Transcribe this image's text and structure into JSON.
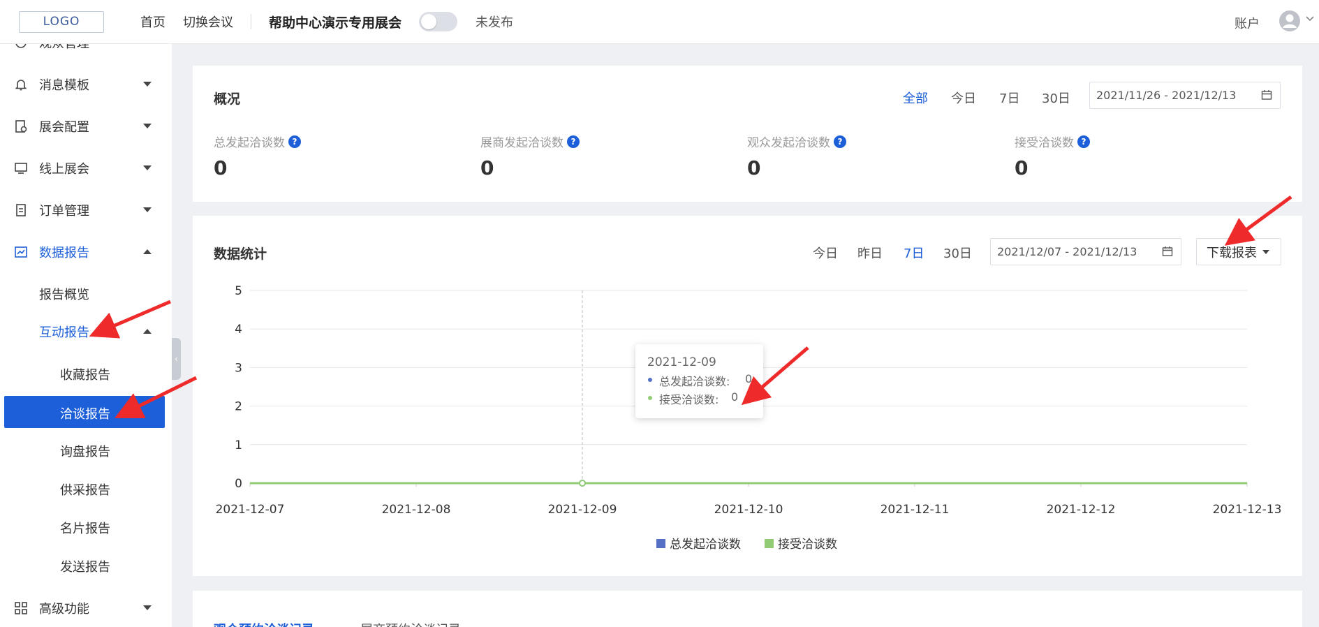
{
  "header": {
    "logo": "LOGO",
    "nav_home": "首页",
    "nav_switch": "切换会议",
    "conference_title": "帮助中心演示专用展会",
    "publish_status": "未发布",
    "account": "账户"
  },
  "sidebar": {
    "partial_top": "观众管理",
    "items": [
      {
        "label": "消息模板",
        "icon": "bell-icon"
      },
      {
        "label": "展会配置",
        "icon": "settings-doc-icon"
      },
      {
        "label": "线上展会",
        "icon": "monitor-icon"
      },
      {
        "label": "订单管理",
        "icon": "order-icon"
      },
      {
        "label": "数据报告",
        "icon": "chart-icon",
        "active": true
      }
    ],
    "report_overview": "报告概览",
    "interaction_report": "互动报告",
    "sub_items": [
      "收藏报告",
      "洽谈报告",
      "询盘报告",
      "供采报告",
      "名片报告",
      "发送报告"
    ],
    "selected": "洽谈报告",
    "advanced": "高级功能"
  },
  "overview": {
    "title": "概况",
    "filters": [
      "全部",
      "今日",
      "7日",
      "30日"
    ],
    "active_filter": "全部",
    "date_range": "2021/11/26 - 2021/12/13",
    "stats": [
      {
        "label": "总发起洽谈数",
        "value": "0"
      },
      {
        "label": "展商发起洽谈数",
        "value": "0"
      },
      {
        "label": "观众发起洽谈数",
        "value": "0"
      },
      {
        "label": "接受洽谈数",
        "value": "0"
      }
    ]
  },
  "stats_card": {
    "title": "数据统计",
    "filters": [
      "今日",
      "昨日",
      "7日",
      "30日"
    ],
    "active_filter": "7日",
    "date_range": "2021/12/07 - 2021/12/13",
    "download": "下载报表"
  },
  "chart_data": {
    "type": "line",
    "x": [
      "2021-12-07",
      "2021-12-08",
      "2021-12-09",
      "2021-12-10",
      "2021-12-11",
      "2021-12-12",
      "2021-12-13"
    ],
    "ylim": [
      0,
      5
    ],
    "yticks": [
      "0",
      "1",
      "2",
      "3",
      "4",
      "5"
    ],
    "grid": true,
    "legend_position": "bottom",
    "series": [
      {
        "name": "总发起洽谈数",
        "color": "#5470c6",
        "values": [
          0,
          0,
          0,
          0,
          0,
          0,
          0
        ]
      },
      {
        "name": "接受洽谈数",
        "color": "#91cc75",
        "values": [
          0,
          0,
          0,
          0,
          0,
          0,
          0
        ]
      }
    ],
    "tooltip": {
      "date": "2021-12-09",
      "rows": [
        {
          "label": "总发起洽谈数:",
          "value": "0"
        },
        {
          "label": "接受洽谈数:",
          "value": "0"
        }
      ]
    }
  },
  "bottom_tabs": [
    "观众预约洽谈记录",
    "展商预约洽谈记录"
  ],
  "colors": {
    "accent": "#1d5fd8",
    "annotation_arrow": "#ee2a2a"
  }
}
